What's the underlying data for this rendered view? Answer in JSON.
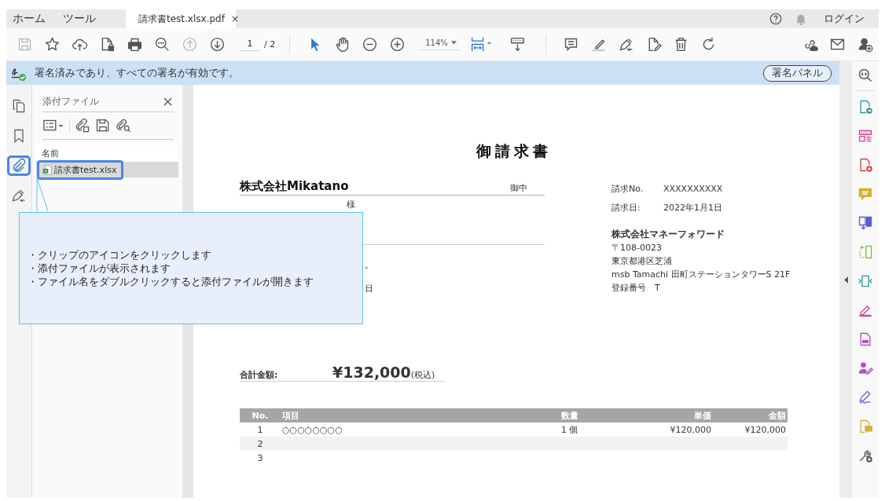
{
  "tabs": [
    {
      "label": "ホーム",
      "selected": false
    },
    {
      "label": "ツール",
      "selected": false
    },
    {
      "label": "請求書test.xlsx.pdf",
      "selected": true,
      "close": "×"
    }
  ],
  "account": {
    "login": "ログイン"
  },
  "toolbar": {
    "page_current": "1",
    "page_total": "/ 2",
    "zoom": "114%"
  },
  "signature_bar": {
    "message": "署名済みであり、すべての署名が有効です。",
    "button": "署名パネル"
  },
  "left_rail": [
    {
      "kind": "pages",
      "selected": false
    },
    {
      "kind": "bookmark",
      "selected": false
    },
    {
      "kind": "attachment",
      "selected": true
    },
    {
      "kind": "signature",
      "selected": false
    }
  ],
  "attachments_panel": {
    "title": "添付ファイル",
    "column_header": "名前",
    "files": [
      {
        "name": "請求書test.xlsx",
        "selected": true
      }
    ]
  },
  "callout": {
    "lines": [
      "・クリップのアイコンをクリックします",
      "・添付ファイルが表示されます",
      "・ファイル名をダブルクリックすると添付ファイルが開きます"
    ]
  },
  "document": {
    "title": "御請求書",
    "customer": "株式会社Mikatano",
    "honorific": "御中",
    "honorific_2": "様",
    "fragments": [
      "。",
      "日"
    ],
    "meta": [
      {
        "label": "請求No.",
        "value": "XXXXXXXXXX"
      },
      {
        "label": "請求日:",
        "value": "2022年1月1日"
      }
    ],
    "issuer": {
      "name": "株式会社マネーフォワード",
      "lines": [
        "〒108-0023",
        "東京都港区芝浦",
        "msb Tamachi 田町ステーションタワーS 21F",
        "登録番号　T"
      ]
    },
    "total": {
      "label": "合計金額:",
      "amount": "¥132,000",
      "note": "(税込)"
    },
    "table": {
      "columns": [
        "No.",
        "項目",
        "数量",
        "単価",
        "金額"
      ],
      "rows": [
        [
          "1",
          "○○○○○○○○",
          "1 個",
          "¥120,000",
          "¥120,000"
        ],
        [
          "2",
          "",
          "",
          "",
          ""
        ],
        [
          "3",
          "",
          "",
          "",
          ""
        ]
      ]
    }
  }
}
